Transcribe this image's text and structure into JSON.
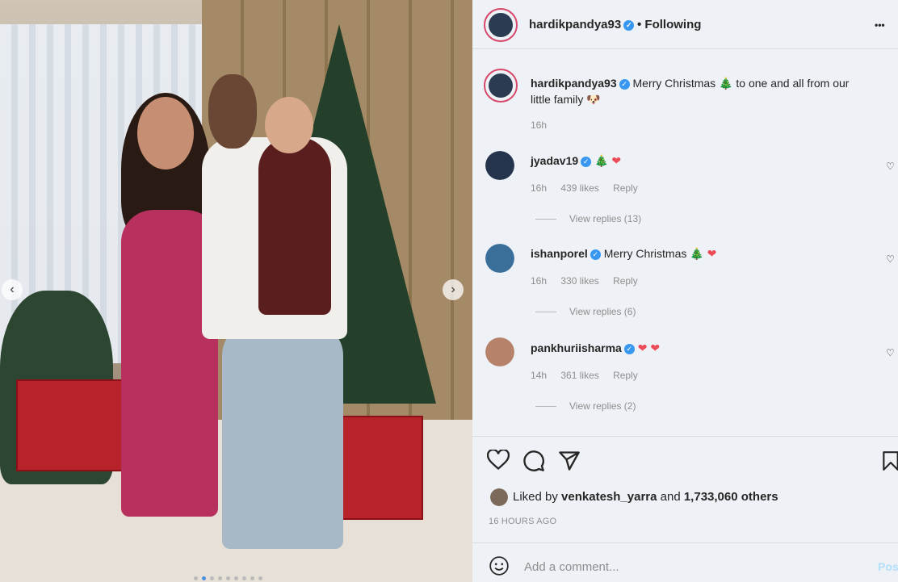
{
  "post": {
    "author": "hardikpandya93",
    "following_label": "Following",
    "more_label": "•••",
    "caption_text": "Merry Christmas",
    "caption_tree": "🎄",
    "caption_rest": "to one and all from our",
    "caption_line2": "little family",
    "caption_emoji": "🐶",
    "caption_time": "16h"
  },
  "comments": [
    {
      "user": "jyadav19",
      "text": "",
      "emoji1": "🎄",
      "emoji2": "❤",
      "time": "16h",
      "likes": "439 likes",
      "reply": "Reply",
      "view_replies": "View replies (13)"
    },
    {
      "user": "ishanporel",
      "text": "Merry Christmas",
      "emoji1": "🎄",
      "emoji2": "❤",
      "time": "16h",
      "likes": "330 likes",
      "reply": "Reply",
      "view_replies": "View replies (6)"
    },
    {
      "user": "pankhuriisharma",
      "text": "",
      "emoji1": "❤",
      "emoji2": "❤",
      "time": "14h",
      "likes": "361 likes",
      "reply": "Reply",
      "view_replies": "View replies (2)"
    }
  ],
  "actions": {
    "like_icon": "heart-icon",
    "comment_icon": "comment-icon",
    "share_icon": "share-icon",
    "save_icon": "bookmark-icon"
  },
  "likes": {
    "prefix": "Liked by",
    "user": "venkatesh_yarra",
    "middle": "and",
    "count": "1,733,060 others"
  },
  "timestamp": "16 HOURS AGO",
  "comment_box": {
    "placeholder": "Add a comment...",
    "post_label": "Post",
    "emoji_icon": "smiley-icon"
  },
  "colors": {
    "verified": "#3897f0",
    "heart": "#ed4956",
    "story_ring": "#d7476b"
  }
}
